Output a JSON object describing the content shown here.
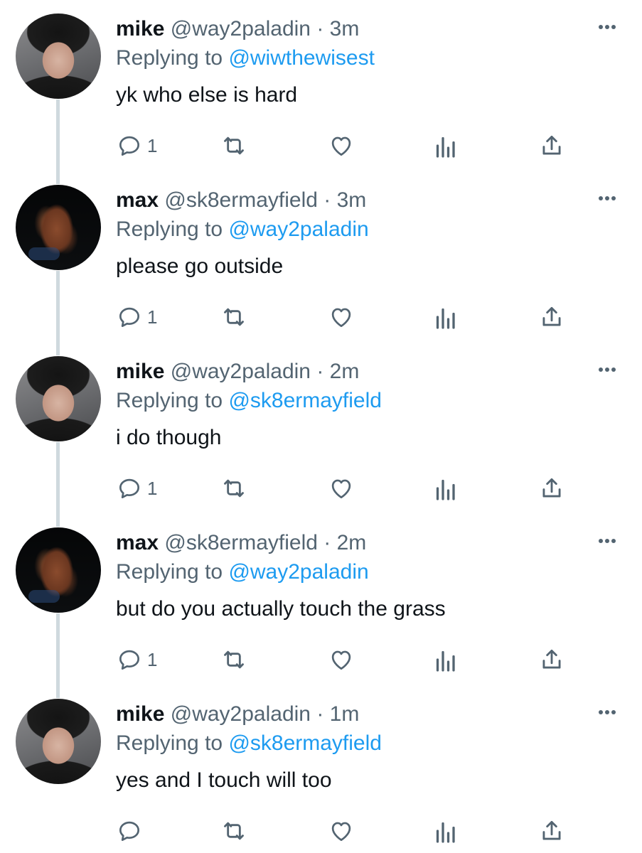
{
  "tweets": [
    {
      "name": "mike",
      "handle": "@way2paladin",
      "time": "3m",
      "replying_label": "Replying to",
      "replying_to": "@wiwthewisest",
      "text": "yk who else is hard",
      "reply_count": "1",
      "avatar": "mike"
    },
    {
      "name": "max",
      "handle": "@sk8ermayfield",
      "time": "3m",
      "replying_label": "Replying to",
      "replying_to": "@way2paladin",
      "text": "please go outside",
      "reply_count": "1",
      "avatar": "max"
    },
    {
      "name": "mike",
      "handle": "@way2paladin",
      "time": "2m",
      "replying_label": "Replying to",
      "replying_to": "@sk8ermayfield",
      "text": "i do though",
      "reply_count": "1",
      "avatar": "mike"
    },
    {
      "name": "max",
      "handle": "@sk8ermayfield",
      "time": "2m",
      "replying_label": "Replying to",
      "replying_to": "@way2paladin",
      "text": "but do you actually touch the grass",
      "reply_count": "1",
      "avatar": "max"
    },
    {
      "name": "mike",
      "handle": "@way2paladin",
      "time": "1m",
      "replying_label": "Replying to",
      "replying_to": "@sk8ermayfield",
      "text": "yes and I touch will too",
      "reply_count": "",
      "avatar": "mike"
    }
  ],
  "separator": "·",
  "icons": {
    "more": "more-dots-icon",
    "reply": "reply-bubble-icon",
    "retweet": "retweet-icon",
    "like": "heart-icon",
    "views": "views-chart-icon",
    "share": "share-icon"
  },
  "colors": {
    "text": "#0f1419",
    "secondary": "#536471",
    "accent": "#1d9bf0",
    "thread_line": "#cfd9de"
  }
}
